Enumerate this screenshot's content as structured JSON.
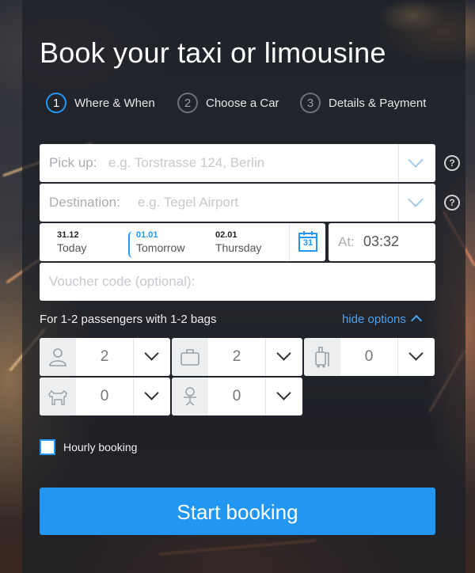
{
  "title": "Book your taxi or limousine",
  "steps": [
    {
      "num": "1",
      "label": "Where & When"
    },
    {
      "num": "2",
      "label": "Choose a Car"
    },
    {
      "num": "3",
      "label": "Details & Payment"
    }
  ],
  "pickup": {
    "label": "Pick up:",
    "placeholder": "e.g. Torstrasse 124, Berlin"
  },
  "destination": {
    "label": "Destination:",
    "placeholder": "e.g. Tegel Airport"
  },
  "help_icon": "?",
  "dates": [
    {
      "date": "31.12",
      "name": "Today"
    },
    {
      "date": "01.01",
      "name": "Tomorrow"
    },
    {
      "date": "02.01",
      "name": "Thursday"
    }
  ],
  "calendar_day": "31",
  "time": {
    "label": "At:",
    "value": "03:32"
  },
  "voucher": {
    "placeholder": "Voucher code (optional):"
  },
  "options": {
    "summary": "For 1-2 passengers with 1-2 bags",
    "hide_label": "hide options",
    "passengers": "2",
    "bags": "2",
    "luggage": "0",
    "pets": "0",
    "child_seats": "0"
  },
  "hourly": {
    "label": "Hourly booking"
  },
  "submit": {
    "label": "Start booking"
  },
  "colors": {
    "accent": "#2196f3",
    "panel": "#1c1e26"
  },
  "icons": [
    "person-icon",
    "bag-icon",
    "trolley-icon",
    "dog-icon",
    "baby-icon",
    "calendar-icon",
    "chevron-down-icon",
    "chevron-up-icon",
    "help-icon"
  ]
}
